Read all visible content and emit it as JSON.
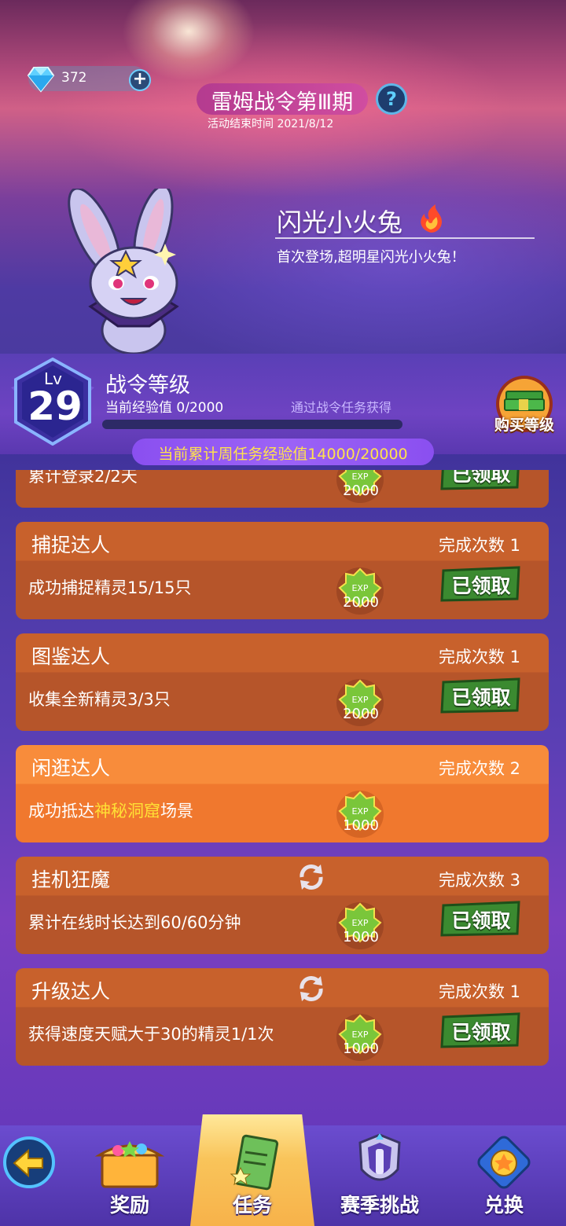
{
  "header": {
    "gem_count": "372",
    "title": "雷姆战令第Ⅲ期",
    "end_time": "活动结束时间 2021/8/12"
  },
  "featured": {
    "name": "闪光小火兔",
    "desc": "首次登场,超明星闪光小火兔！"
  },
  "level": {
    "lv_label": "Lv",
    "lv_value": "29",
    "title": "战令等级",
    "exp_text": "当前经验值 0/2000",
    "exp_progress": 0,
    "hint": "通过战令任务获得",
    "buy_label": "购买等级",
    "week_progress_text": "当前累计周任务经验值14000/20000"
  },
  "tasks": [
    {
      "title": "",
      "desc": "累计登录2/2天",
      "exp": "2000",
      "count": "",
      "claimed": "已领取",
      "refresh": false,
      "active": false
    },
    {
      "title": "捕捉达人",
      "desc": "成功捕捉精灵15/15只",
      "exp": "2000",
      "count": "完成次数 1",
      "claimed": "已领取",
      "refresh": false,
      "active": false
    },
    {
      "title": "图鉴达人",
      "desc": "收集全新精灵3/3只",
      "exp": "2000",
      "count": "完成次数 1",
      "claimed": "已领取",
      "refresh": false,
      "active": false
    },
    {
      "title": "闲逛达人",
      "desc_pre": "成功抵达",
      "desc_hl": "神秘洞窟",
      "desc_post": "场景",
      "exp": "1000",
      "count": "完成次数 2",
      "claimed": "",
      "refresh": false,
      "active": true
    },
    {
      "title": "挂机狂魔",
      "desc": "累计在线时长达到60/60分钟",
      "exp": "1000",
      "count": "完成次数 3",
      "claimed": "已领取",
      "refresh": true,
      "active": false
    },
    {
      "title": "升级达人",
      "desc": "获得速度天赋大于30的精灵1/1次",
      "exp": "1000",
      "count": "完成次数 1",
      "claimed": "已领取",
      "refresh": true,
      "active": false
    }
  ],
  "exp_badge": "EXP",
  "nav": {
    "reward": "奖励",
    "task": "任务",
    "season": "赛季挑战",
    "exchange": "兑换"
  },
  "colors": {
    "highlight": "#ffe135",
    "week_text": "#ffe24d",
    "claimed_bg": "#3b8a30"
  }
}
